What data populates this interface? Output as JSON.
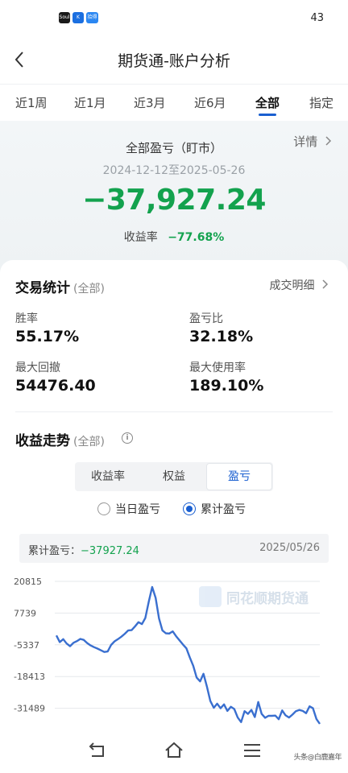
{
  "status_bar": {
    "battery": "43",
    "icons": [
      {
        "name": "soul-app-icon",
        "text": "Soul"
      },
      {
        "name": "k-app-icon",
        "text": "K"
      },
      {
        "name": "tonghuashun-app-icon",
        "text": "拾得"
      }
    ]
  },
  "header": {
    "title": "期货通-账户分析",
    "back_icon": "chevron-left-icon"
  },
  "tabs": [
    {
      "label": "近1周",
      "active": false
    },
    {
      "label": "近1月",
      "active": false
    },
    {
      "label": "近3月",
      "active": false
    },
    {
      "label": "近6月",
      "active": false
    },
    {
      "label": "全部",
      "active": true
    },
    {
      "label": "指定",
      "active": false
    }
  ],
  "summary": {
    "label": "全部盈亏（盯市）",
    "detail_link": "详情",
    "date_range": "2024-12-12至2025-05-26",
    "total_pnl": "−37,927.24",
    "return_label": "收益率",
    "return_value": "−77.68%",
    "accent_color": "#13a24e"
  },
  "trade_stats": {
    "title": "交易统计",
    "scope": "(全部)",
    "detail_link": "成交明细",
    "items": [
      {
        "label": "胜率",
        "value": "55.17%"
      },
      {
        "label": "盈亏比",
        "value": "32.18%"
      },
      {
        "label": "最大回撤",
        "value": "54476.40"
      },
      {
        "label": "最大使用率",
        "value": "189.10%"
      }
    ]
  },
  "trend": {
    "title": "收益走势",
    "scope": "(全部)",
    "info_icon": "info-icon",
    "segments": [
      {
        "label": "收益率",
        "active": false
      },
      {
        "label": "权益",
        "active": false
      },
      {
        "label": "盈亏",
        "active": true
      }
    ],
    "radios": [
      {
        "label": "当日盈亏",
        "checked": false
      },
      {
        "label": "累计盈亏",
        "checked": true
      }
    ],
    "tooltip": {
      "label": "累计盈亏：",
      "value": "−37927.24",
      "date": "2025/05/26"
    },
    "watermark": "同花顺期货通"
  },
  "chart_data": {
    "type": "line",
    "y_ticks": [
      "20815",
      "7739",
      "-5337",
      "-18413",
      "-31489"
    ],
    "ylim": [
      -37927.24,
      20815
    ],
    "series": [
      {
        "color": "#3a6fcf",
        "values": [
          -1500,
          -4200,
          -3000,
          -4800,
          -5900,
          -4500,
          -3800,
          -2900,
          -3300,
          -4600,
          -5600,
          -6300,
          -6900,
          -7600,
          -8300,
          -8100,
          -5400,
          -3900,
          -3000,
          -2000,
          -800,
          600,
          700,
          2300,
          4000,
          3200,
          5700,
          12500,
          18500,
          14000,
          5500,
          600,
          -600,
          -700,
          200,
          -1800,
          -3500,
          -5200,
          -6800,
          -10500,
          -14000,
          -18800,
          -20400,
          -17300,
          -22600,
          -28500,
          -31300,
          -29600,
          -31500,
          -29900,
          -32600,
          -30900,
          -31800,
          -35300,
          -37200,
          -32700,
          -33800,
          -32200,
          -35100,
          -28900,
          -33800,
          -35400,
          -34600,
          -34600,
          -34500,
          -36000,
          -32400,
          -34400,
          -35300,
          -34100,
          -32700,
          -32200,
          -32600,
          -33500,
          -30700,
          -31500,
          -35900,
          -37927.24
        ]
      }
    ]
  },
  "system_nav": {
    "caption": "头条@白鹿嘉年",
    "buttons": [
      "back-nav-icon",
      "home-nav-icon",
      "menu-nav-icon"
    ]
  }
}
